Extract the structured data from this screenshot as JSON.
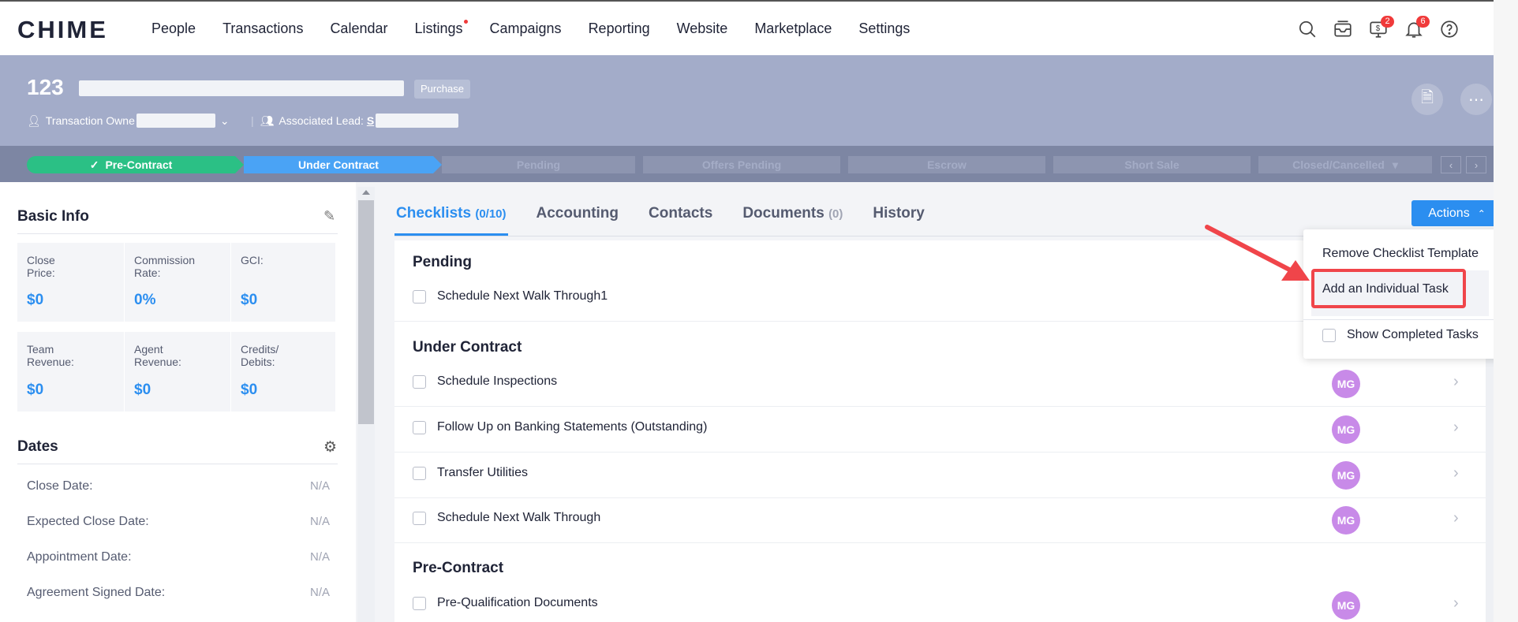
{
  "nav": {
    "logo": "CHIME",
    "items": [
      "People",
      "Transactions",
      "Calendar",
      "Listings",
      "Campaigns",
      "Reporting",
      "Website",
      "Marketplace",
      "Settings"
    ],
    "badges": {
      "messages": "2",
      "notifications": "6"
    }
  },
  "header": {
    "title": "123",
    "badge": "Purchase",
    "owner_label": "Transaction Owne",
    "lead_label": "Associated Lead:",
    "lead_value": "S"
  },
  "stages": [
    "Pre-Contract",
    "Under Contract",
    "Pending",
    "Offers Pending",
    "Escrow",
    "Short Sale",
    "Closed/Cancelled"
  ],
  "basic_info": {
    "title": "Basic Info",
    "row1": [
      {
        "label": "Close Price:",
        "value": "$0"
      },
      {
        "label": "Commission Rate:",
        "value": "0%"
      },
      {
        "label": "GCI:",
        "value": "$0"
      }
    ],
    "row2": [
      {
        "label": "Team Revenue:",
        "value": "$0"
      },
      {
        "label": "Agent Revenue:",
        "value": "$0"
      },
      {
        "label": "Credits/ Debits:",
        "value": "$0"
      }
    ]
  },
  "dates": {
    "title": "Dates",
    "rows": [
      {
        "label": "Close Date:",
        "value": "N/A"
      },
      {
        "label": "Expected Close Date:",
        "value": "N/A"
      },
      {
        "label": "Appointment Date:",
        "value": "N/A"
      },
      {
        "label": "Agreement Signed Date:",
        "value": "N/A"
      }
    ]
  },
  "tabs": [
    {
      "label": "Checklists",
      "count": "(0/10)"
    },
    {
      "label": "Accounting",
      "count": ""
    },
    {
      "label": "Contacts",
      "count": ""
    },
    {
      "label": "Documents",
      "count": "(0)"
    },
    {
      "label": "History",
      "count": ""
    }
  ],
  "actions_label": "Actions",
  "dropdown": {
    "remove_template": "Remove Checklist Template",
    "add_task": "Add an Individual Task",
    "show_completed": "Show Completed Tasks"
  },
  "groups": [
    {
      "title": "Pending",
      "tasks": [
        {
          "name": "Schedule Next Walk Through1",
          "assignee": ""
        }
      ]
    },
    {
      "title": "Under Contract",
      "tasks": [
        {
          "name": "Schedule Inspections",
          "assignee": "MG"
        },
        {
          "name": "Follow Up on Banking Statements (Outstanding)",
          "assignee": "MG"
        },
        {
          "name": "Transfer Utilities",
          "assignee": "MG"
        },
        {
          "name": "Schedule Next Walk Through",
          "assignee": "MG"
        }
      ]
    },
    {
      "title": "Pre-Contract",
      "tasks": [
        {
          "name": "Pre-Qualification Documents",
          "assignee": "MG"
        }
      ]
    }
  ],
  "colors": {
    "accent": "#2b8ef0",
    "done_stage": "#2bc085",
    "highlight": "#f0454a",
    "avatar": "#c88ae8"
  }
}
